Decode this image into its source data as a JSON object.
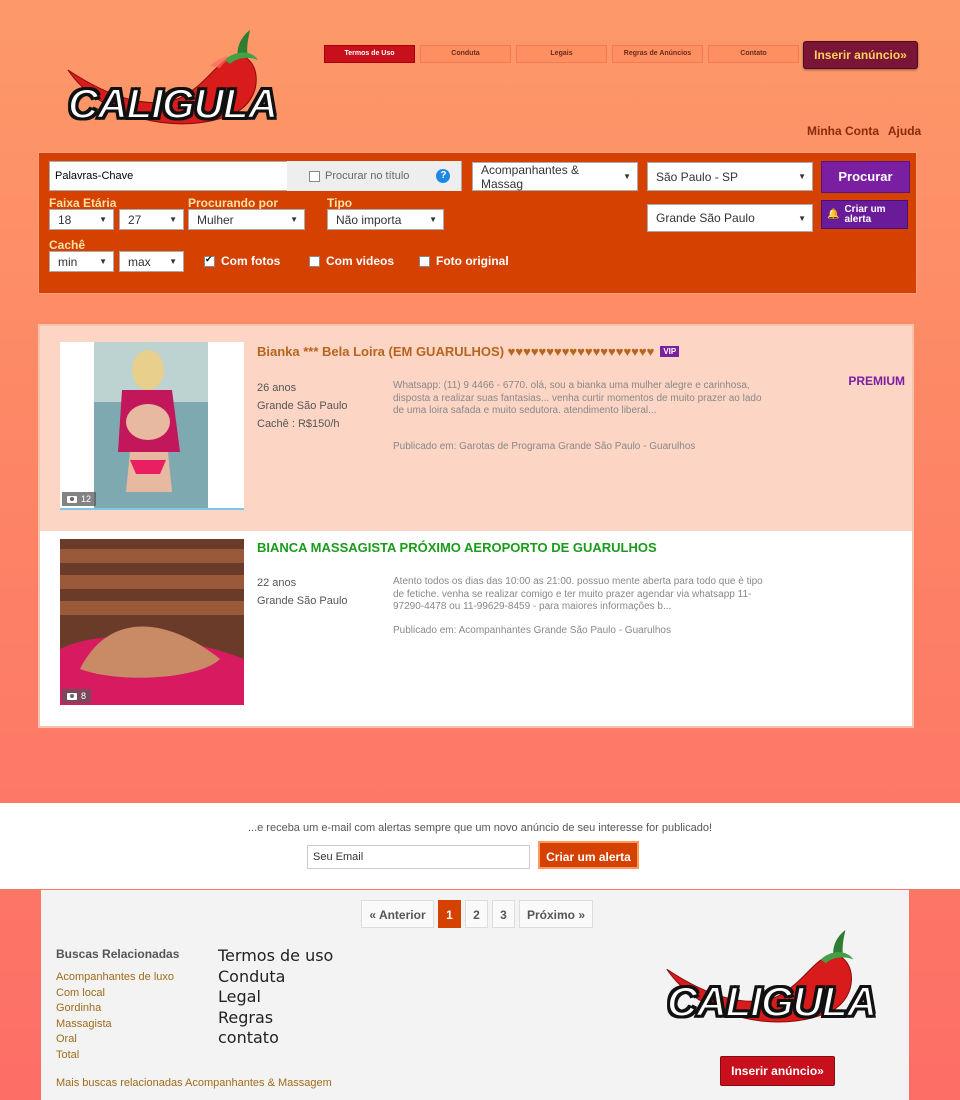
{
  "brand": {
    "name": "CALIGULA"
  },
  "nav": {
    "items": [
      "Termos de Uso",
      "Conduta",
      "Legais",
      "Regras de Anúncios",
      "Contato"
    ],
    "insert_label": "Inserir anúncio»"
  },
  "account": {
    "my_account": "Minha Conta",
    "help": "Ajuda"
  },
  "search": {
    "keyword_value": "Palavras-Chave",
    "title_only_label": "Procurar no título",
    "category": "Acompanhantes & Massag",
    "state": "São Paulo - SP",
    "region": "Grande São Paulo",
    "search_button": "Procurar",
    "alert_button": "Criar um alerta",
    "age_label": "Faixa Etária",
    "age_min": "18",
    "age_max": "27",
    "looking_label": "Procurando por",
    "looking_value": "Mulher",
    "type_label": "Tipo",
    "type_value": "Não importa",
    "fee_label": "Cachê",
    "fee_min": "min",
    "fee_max": "max",
    "with_photos": "Com fotos",
    "with_videos": "Com videos",
    "original_photo": "Foto original"
  },
  "listings": [
    {
      "title": "Bianka *** Bela Loira (EM GUARULHOS) ♥♥♥♥♥♥♥♥♥♥♥♥♥♥♥♥♥♥♥",
      "badge": "VIP",
      "age": "26 anos",
      "location": "Grande São Paulo",
      "fee": "Cachê : R$150/h",
      "description": "Whatsapp: (11) 9 4466 - 6770. olá, sou a bianka uma mulher alegre e carinhosa, disposta a realizar suas fantasias... venha curtir momentos de muito prazer ao lado de uma loira safada e muito sedutora. atendimento liberal...",
      "published": "Publicado em: Garotas de Programa Grande São Paulo - Guarulhos",
      "tier": "PREMIUM",
      "photos": "12",
      "title_color": "#b5651d"
    },
    {
      "title": "BIANCA MASSAGISTA PRÓXIMO AEROPORTO DE GUARULHOS",
      "age": "22 anos",
      "location": "Grande São Paulo",
      "description": "Atento todos os dias das 10:00 as 21:00. possuo mente aberta para todo que è tipo de fetiche. venha se realizar comigo e ter muito prazer agendar via whatsapp 11-97290-4478 ou 11-99629-8459 - para maiores informações b...",
      "published": "Publicado em: Acompanhantes Grande São Paulo - Guarulhos",
      "photos": "8",
      "title_color": "#1a9b1a"
    }
  ],
  "alert_strip": {
    "message": "...e receba um e-mail com alertas sempre que um novo anúncio de seu interesse for publicado!",
    "email_value": "Seu Email",
    "button": "Criar um alerta"
  },
  "pagination": {
    "prev": "« Anterior",
    "pages": [
      "1",
      "2",
      "3"
    ],
    "current": "1",
    "next": "Próximo »"
  },
  "footer": {
    "related_title": "Buscas Relacionadas",
    "related": [
      "Acompanhantes de luxo",
      "Com local",
      "Gordinha",
      "Massagista",
      "Oral",
      "Total"
    ],
    "more_related": "Mais buscas relacionadas Acompanhantes & Massagem",
    "links": [
      "Termos de uso",
      "Conduta",
      "Legal",
      "Regras",
      "contato"
    ],
    "insert_label": "Inserir anúncio»"
  },
  "colors": {
    "accent": "#d44100",
    "purple": "#7b1fa2",
    "red": "#c8101c"
  }
}
